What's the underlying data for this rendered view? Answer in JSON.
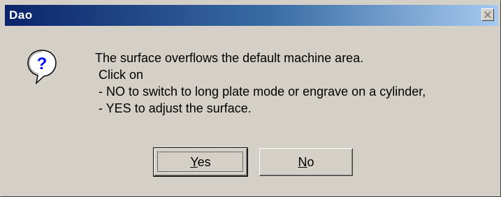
{
  "window": {
    "title": "Dao"
  },
  "icons": {
    "message_icon": "question-icon",
    "close_icon": "close-icon"
  },
  "message": {
    "lines": [
      "The surface overflows the default machine area.",
      " Click on",
      " - NO to switch to long plate mode or engrave on a cylinder,",
      " - YES to adjust the surface."
    ]
  },
  "buttons": {
    "yes": {
      "mnemonic": "Y",
      "rest": "es"
    },
    "no": {
      "mnemonic": "N",
      "rest": "o"
    }
  },
  "colors": {
    "title_start": "#0a246a",
    "title_end": "#a6caf0",
    "face": "#d4d0c8",
    "icon_blue": "#0000ff"
  }
}
